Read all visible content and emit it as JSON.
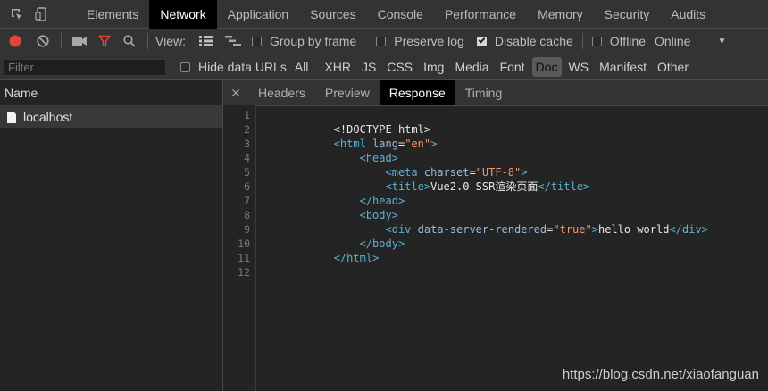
{
  "tabs": [
    "Elements",
    "Network",
    "Application",
    "Sources",
    "Console",
    "Performance",
    "Memory",
    "Security",
    "Audits"
  ],
  "active_tab": "Network",
  "toolbar": {
    "view_label": "View:",
    "group_by_frame": "Group by frame",
    "preserve_log": "Preserve log",
    "disable_cache": "Disable cache",
    "offline": "Offline",
    "throttle": "Online"
  },
  "checkbox_state": {
    "group_by_frame": false,
    "preserve_log": false,
    "disable_cache": true,
    "offline": false,
    "hide_data_urls": false
  },
  "filterbar": {
    "filter_placeholder": "Filter",
    "hide_data_urls": "Hide data URLs",
    "types": [
      "All",
      "XHR",
      "JS",
      "CSS",
      "Img",
      "Media",
      "Font",
      "Doc",
      "WS",
      "Manifest",
      "Other"
    ],
    "active_type": "Doc"
  },
  "requests": {
    "header": "Name",
    "items": [
      {
        "name": "localhost"
      }
    ]
  },
  "detail": {
    "tabs": [
      "Headers",
      "Preview",
      "Response",
      "Timing"
    ],
    "active": "Response",
    "code_lines": [
      "",
      "            <!DOCTYPE html>",
      "            <html lang=\"en\">",
      "                <head>",
      "                    <meta charset=\"UTF-8\">",
      "                    <title>Vue2.0 SSR渲染页面</title>",
      "                </head>",
      "                <body>",
      "                    <div data-server-rendered=\"true\">hello world</div>",
      "                </body>",
      "            </html>",
      ""
    ]
  },
  "watermark": "https://blog.csdn.net/xiaofanguan",
  "colors": {
    "record": "#e0453a",
    "filter_icon": "#e0453a",
    "tag": "#5db0d7",
    "attr": "#9bbbdc",
    "string": "#f29766"
  },
  "icons": [
    "inspect-icon",
    "device-icon",
    "record-icon",
    "clear-icon",
    "camera-icon",
    "filter-icon",
    "search-icon",
    "large-rows-icon",
    "overview-icon",
    "dropdown-arrow-icon",
    "document-icon",
    "close-icon"
  ]
}
